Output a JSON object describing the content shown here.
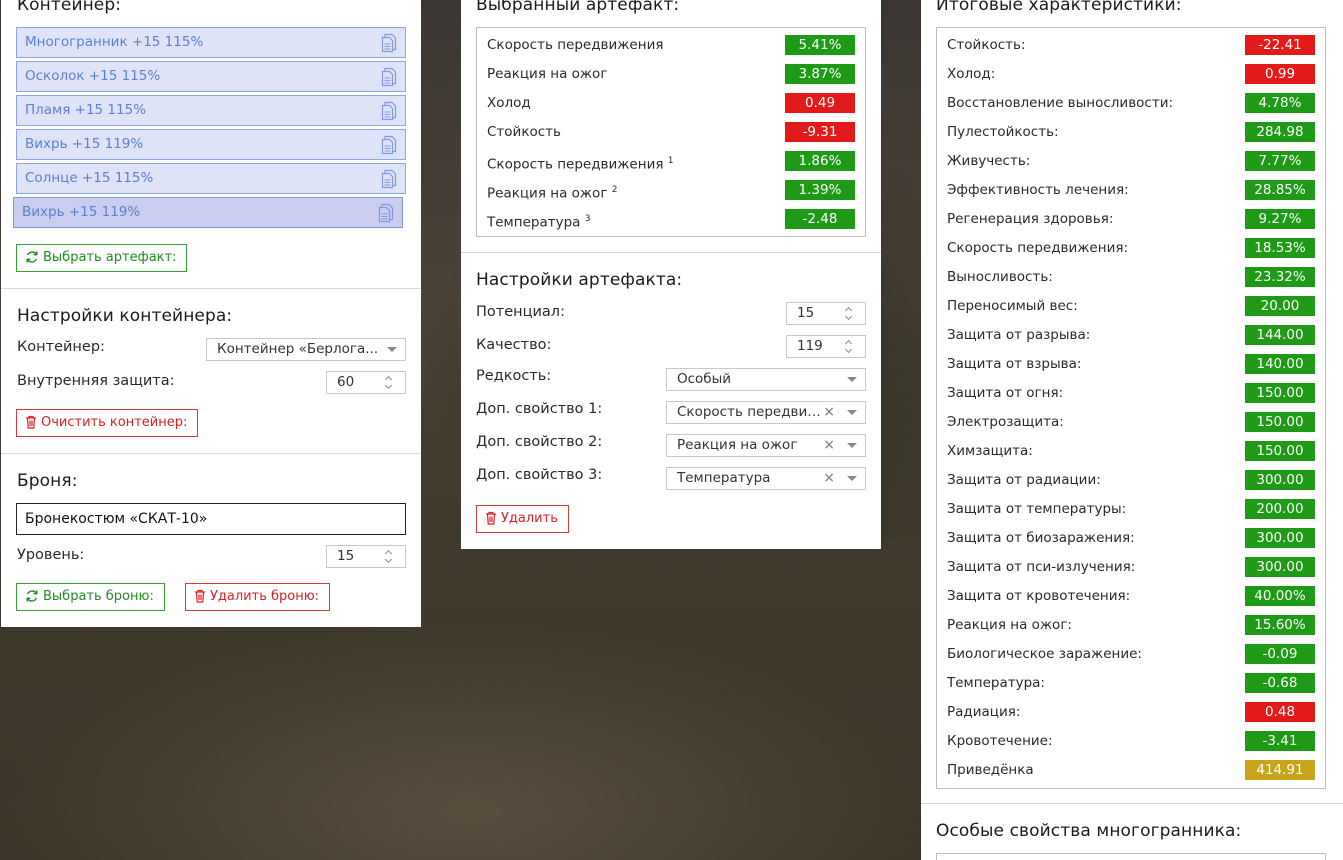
{
  "container_panel": {
    "title": "Контейнер:",
    "items": [
      {
        "label": "Многогранник +15 115%"
      },
      {
        "label": "Осколок +15 115%"
      },
      {
        "label": "Пламя +15 115%"
      },
      {
        "label": "Вихрь +15 119%"
      },
      {
        "label": "Солнце +15 115%"
      },
      {
        "label": "Вихрь +15 119%"
      }
    ],
    "select_button": "Выбрать артефакт:"
  },
  "container_settings": {
    "title": "Настройки контейнера:",
    "container_label": "Контейнер:",
    "container_value": "Контейнер «Берлога...",
    "protection_label": "Внутренняя защита:",
    "protection_value": "60",
    "clear_button": "Очистить контейнер:"
  },
  "armor": {
    "title": "Броня:",
    "name_value": "Бронекостюм «СКАТ-10»",
    "level_label": "Уровень:",
    "level_value": "15",
    "select_button": "Выбрать броню:",
    "delete_button": "Удалить броню:"
  },
  "selected_artifact": {
    "title": "Выбранный артефакт:",
    "stats": [
      {
        "name": "Скорость передвижения",
        "sup": "",
        "value": "5.41%",
        "kind": "pos"
      },
      {
        "name": "Реакция на ожог",
        "sup": "",
        "value": "3.87%",
        "kind": "pos"
      },
      {
        "name": "Холод",
        "sup": "",
        "value": "0.49",
        "kind": "neg"
      },
      {
        "name": "Стойкость",
        "sup": "",
        "value": "-9.31",
        "kind": "neg"
      },
      {
        "name": "Скорость передвижения",
        "sup": "1",
        "value": "1.86%",
        "kind": "pos"
      },
      {
        "name": "Реакция на ожог",
        "sup": "2",
        "value": "1.39%",
        "kind": "pos"
      },
      {
        "name": "Температура",
        "sup": "3",
        "value": "-2.48",
        "kind": "pos"
      }
    ]
  },
  "artifact_settings": {
    "title": "Настройки артефакта:",
    "potential_label": "Потенциал:",
    "potential_value": "15",
    "quality_label": "Качество:",
    "quality_value": "119",
    "rarity_label": "Редкость:",
    "rarity_value": "Особый",
    "prop1_label": "Доп. свойство 1:",
    "prop1_value": "Скорость передвижения",
    "prop2_label": "Доп. свойство 2:",
    "prop2_value": "Реакция на ожог",
    "prop3_label": "Доп. свойство 3:",
    "prop3_value": "Температура",
    "clear_symbol": "×",
    "delete_button": "Удалить"
  },
  "totals": {
    "title": "Итоговые характеристики:",
    "stats": [
      {
        "name": "Стойкость:",
        "value": "-22.41",
        "kind": "neg"
      },
      {
        "name": "Холод:",
        "value": "0.99",
        "kind": "neg"
      },
      {
        "name": "Восстановление выносливости:",
        "value": "4.78%",
        "kind": "pos"
      },
      {
        "name": "Пулестойкость:",
        "value": "284.98",
        "kind": "pos"
      },
      {
        "name": "Живучесть:",
        "value": "7.77%",
        "kind": "pos"
      },
      {
        "name": "Эффективность лечения:",
        "value": "28.85%",
        "kind": "pos"
      },
      {
        "name": "Регенерация здоровья:",
        "value": "9.27%",
        "kind": "pos"
      },
      {
        "name": "Скорость передвижения:",
        "value": "18.53%",
        "kind": "pos"
      },
      {
        "name": "Выносливость:",
        "value": "23.32%",
        "kind": "pos"
      },
      {
        "name": "Переносимый вес:",
        "value": "20.00",
        "kind": "pos"
      },
      {
        "name": "Защита от разрыва:",
        "value": "144.00",
        "kind": "pos"
      },
      {
        "name": "Защита от взрыва:",
        "value": "140.00",
        "kind": "pos"
      },
      {
        "name": "Защита от огня:",
        "value": "150.00",
        "kind": "pos"
      },
      {
        "name": "Электрозащита:",
        "value": "150.00",
        "kind": "pos"
      },
      {
        "name": "Химзащита:",
        "value": "150.00",
        "kind": "pos"
      },
      {
        "name": "Защита от радиации:",
        "value": "300.00",
        "kind": "pos"
      },
      {
        "name": "Защита от температуры:",
        "value": "200.00",
        "kind": "pos"
      },
      {
        "name": "Защита от биозаражения:",
        "value": "300.00",
        "kind": "pos"
      },
      {
        "name": "Защита от пси-излучения:",
        "value": "300.00",
        "kind": "pos"
      },
      {
        "name": "Защита от кровотечения:",
        "value": "40.00%",
        "kind": "pos"
      },
      {
        "name": "Реакция на ожог:",
        "value": "15.60%",
        "kind": "pos"
      },
      {
        "name": "Биологическое заражение:",
        "value": "-0.09",
        "kind": "pos"
      },
      {
        "name": "Температура:",
        "value": "-0.68",
        "kind": "pos"
      },
      {
        "name": "Радиация:",
        "value": "0.48",
        "kind": "neg"
      },
      {
        "name": "Кровотечение:",
        "value": "-3.41",
        "kind": "pos"
      },
      {
        "name": "Приведёнка",
        "value": "414.91",
        "kind": "gold"
      }
    ]
  },
  "special_props": {
    "title": "Особые свойства многогранника:"
  },
  "icons": {
    "copy": "copy-icon",
    "refresh": "refresh-icon",
    "trash": "trash-icon"
  },
  "colors": {
    "positive": "#1e9a17",
    "negative": "#e21a1a",
    "highlight": "#c8a41a",
    "item_bg": "#dfe3f7",
    "item_text": "#5b7fd6"
  }
}
